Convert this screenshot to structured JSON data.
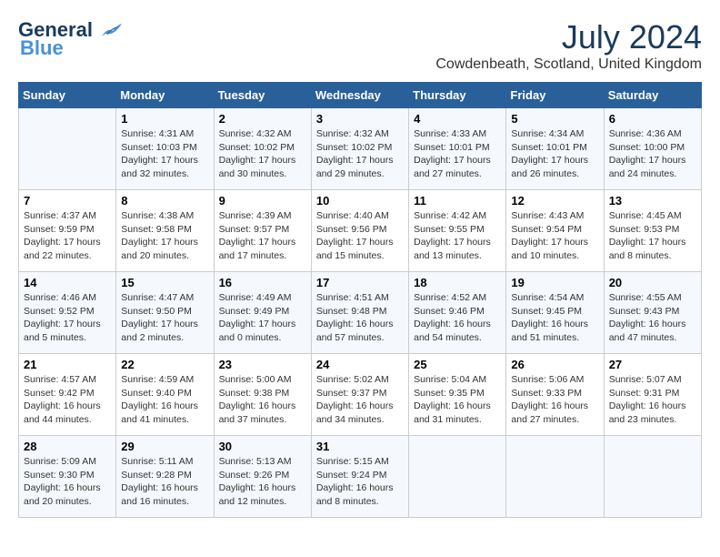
{
  "header": {
    "logo_line1": "General",
    "logo_line2": "Blue",
    "month_title": "July 2024",
    "location": "Cowdenbeath, Scotland, United Kingdom"
  },
  "days_of_week": [
    "Sunday",
    "Monday",
    "Tuesday",
    "Wednesday",
    "Thursday",
    "Friday",
    "Saturday"
  ],
  "weeks": [
    [
      {
        "day": "",
        "info": ""
      },
      {
        "day": "1",
        "info": "Sunrise: 4:31 AM\nSunset: 10:03 PM\nDaylight: 17 hours\nand 32 minutes."
      },
      {
        "day": "2",
        "info": "Sunrise: 4:32 AM\nSunset: 10:02 PM\nDaylight: 17 hours\nand 30 minutes."
      },
      {
        "day": "3",
        "info": "Sunrise: 4:32 AM\nSunset: 10:02 PM\nDaylight: 17 hours\nand 29 minutes."
      },
      {
        "day": "4",
        "info": "Sunrise: 4:33 AM\nSunset: 10:01 PM\nDaylight: 17 hours\nand 27 minutes."
      },
      {
        "day": "5",
        "info": "Sunrise: 4:34 AM\nSunset: 10:01 PM\nDaylight: 17 hours\nand 26 minutes."
      },
      {
        "day": "6",
        "info": "Sunrise: 4:36 AM\nSunset: 10:00 PM\nDaylight: 17 hours\nand 24 minutes."
      }
    ],
    [
      {
        "day": "7",
        "info": "Sunrise: 4:37 AM\nSunset: 9:59 PM\nDaylight: 17 hours\nand 22 minutes."
      },
      {
        "day": "8",
        "info": "Sunrise: 4:38 AM\nSunset: 9:58 PM\nDaylight: 17 hours\nand 20 minutes."
      },
      {
        "day": "9",
        "info": "Sunrise: 4:39 AM\nSunset: 9:57 PM\nDaylight: 17 hours\nand 17 minutes."
      },
      {
        "day": "10",
        "info": "Sunrise: 4:40 AM\nSunset: 9:56 PM\nDaylight: 17 hours\nand 15 minutes."
      },
      {
        "day": "11",
        "info": "Sunrise: 4:42 AM\nSunset: 9:55 PM\nDaylight: 17 hours\nand 13 minutes."
      },
      {
        "day": "12",
        "info": "Sunrise: 4:43 AM\nSunset: 9:54 PM\nDaylight: 17 hours\nand 10 minutes."
      },
      {
        "day": "13",
        "info": "Sunrise: 4:45 AM\nSunset: 9:53 PM\nDaylight: 17 hours\nand 8 minutes."
      }
    ],
    [
      {
        "day": "14",
        "info": "Sunrise: 4:46 AM\nSunset: 9:52 PM\nDaylight: 17 hours\nand 5 minutes."
      },
      {
        "day": "15",
        "info": "Sunrise: 4:47 AM\nSunset: 9:50 PM\nDaylight: 17 hours\nand 2 minutes."
      },
      {
        "day": "16",
        "info": "Sunrise: 4:49 AM\nSunset: 9:49 PM\nDaylight: 17 hours\nand 0 minutes."
      },
      {
        "day": "17",
        "info": "Sunrise: 4:51 AM\nSunset: 9:48 PM\nDaylight: 16 hours\nand 57 minutes."
      },
      {
        "day": "18",
        "info": "Sunrise: 4:52 AM\nSunset: 9:46 PM\nDaylight: 16 hours\nand 54 minutes."
      },
      {
        "day": "19",
        "info": "Sunrise: 4:54 AM\nSunset: 9:45 PM\nDaylight: 16 hours\nand 51 minutes."
      },
      {
        "day": "20",
        "info": "Sunrise: 4:55 AM\nSunset: 9:43 PM\nDaylight: 16 hours\nand 47 minutes."
      }
    ],
    [
      {
        "day": "21",
        "info": "Sunrise: 4:57 AM\nSunset: 9:42 PM\nDaylight: 16 hours\nand 44 minutes."
      },
      {
        "day": "22",
        "info": "Sunrise: 4:59 AM\nSunset: 9:40 PM\nDaylight: 16 hours\nand 41 minutes."
      },
      {
        "day": "23",
        "info": "Sunrise: 5:00 AM\nSunset: 9:38 PM\nDaylight: 16 hours\nand 37 minutes."
      },
      {
        "day": "24",
        "info": "Sunrise: 5:02 AM\nSunset: 9:37 PM\nDaylight: 16 hours\nand 34 minutes."
      },
      {
        "day": "25",
        "info": "Sunrise: 5:04 AM\nSunset: 9:35 PM\nDaylight: 16 hours\nand 31 minutes."
      },
      {
        "day": "26",
        "info": "Sunrise: 5:06 AM\nSunset: 9:33 PM\nDaylight: 16 hours\nand 27 minutes."
      },
      {
        "day": "27",
        "info": "Sunrise: 5:07 AM\nSunset: 9:31 PM\nDaylight: 16 hours\nand 23 minutes."
      }
    ],
    [
      {
        "day": "28",
        "info": "Sunrise: 5:09 AM\nSunset: 9:30 PM\nDaylight: 16 hours\nand 20 minutes."
      },
      {
        "day": "29",
        "info": "Sunrise: 5:11 AM\nSunset: 9:28 PM\nDaylight: 16 hours\nand 16 minutes."
      },
      {
        "day": "30",
        "info": "Sunrise: 5:13 AM\nSunset: 9:26 PM\nDaylight: 16 hours\nand 12 minutes."
      },
      {
        "day": "31",
        "info": "Sunrise: 5:15 AM\nSunset: 9:24 PM\nDaylight: 16 hours\nand 8 minutes."
      },
      {
        "day": "",
        "info": ""
      },
      {
        "day": "",
        "info": ""
      },
      {
        "day": "",
        "info": ""
      }
    ]
  ]
}
